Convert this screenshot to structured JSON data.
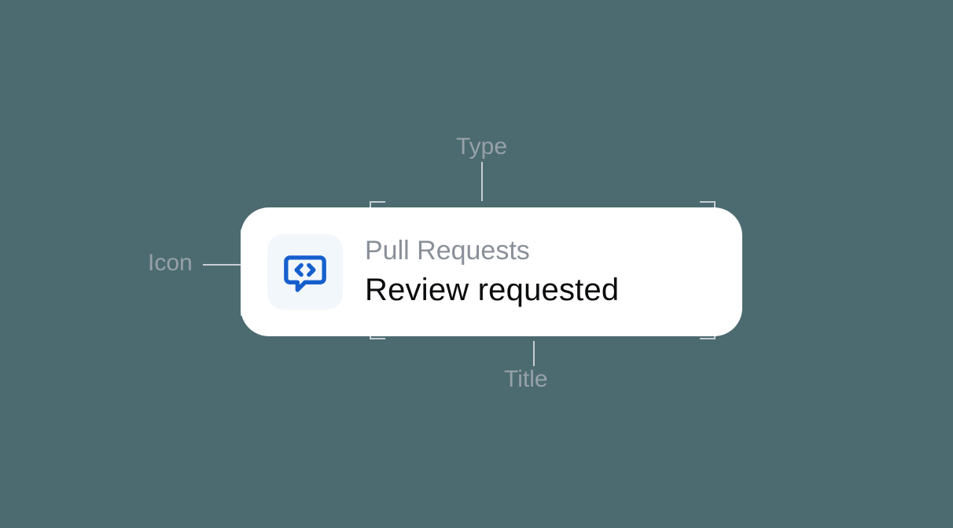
{
  "annotations": {
    "type_label": "Type",
    "icon_label": "Icon",
    "title_label": "Title"
  },
  "card": {
    "icon_name": "code-review-icon",
    "type": "Pull Requests",
    "title": "Review requested"
  },
  "colors": {
    "background": "#4c6b70",
    "card_bg": "#ffffff",
    "icon_bg": "#f2f7fc",
    "icon_fg": "#155fcd",
    "type_fg": "#8a9099",
    "title_fg": "#0b0c0e",
    "anno_fg": "#97a1aa",
    "bracket": "#c7ced5"
  }
}
